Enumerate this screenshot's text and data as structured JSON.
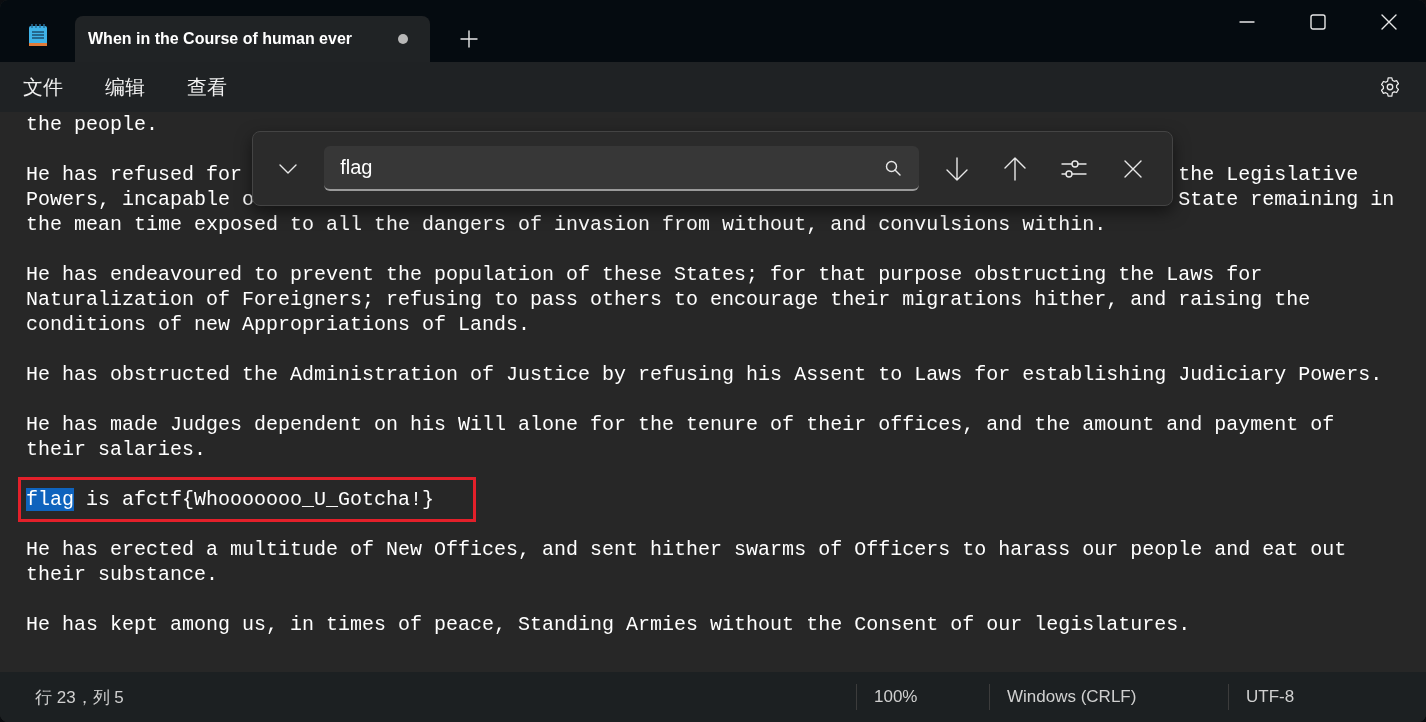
{
  "tab": {
    "label": "When in the Course of human ever",
    "selected": true,
    "unsaved": true
  },
  "menu": [
    {
      "label": "文件"
    },
    {
      "label": "编辑"
    },
    {
      "label": "查看"
    }
  ],
  "find": {
    "value": "flag"
  },
  "lines": [
    {
      "kind": "text",
      "text": "the people."
    },
    {
      "kind": "blank"
    },
    {
      "kind": "split",
      "text": "He has refused for ",
      "right": "the Legislative"
    },
    {
      "kind": "split",
      "text": "Powers, incapable o",
      "right": "State remaining in"
    },
    {
      "kind": "text",
      "text": "the mean time exposed to all the dangers of invasion from without, and convulsions within."
    },
    {
      "kind": "blank"
    },
    {
      "kind": "text",
      "text": "He has endeavoured to prevent the population of these States; for that purpose obstructing the Laws for"
    },
    {
      "kind": "text",
      "text": "Naturalization of Foreigners; refusing to pass others to encourage their migrations hither, and raising the"
    },
    {
      "kind": "text",
      "text": "conditions of new Appropriations of Lands."
    },
    {
      "kind": "blank"
    },
    {
      "kind": "text",
      "text": "He has obstructed the Administration of Justice by refusing his Assent to Laws for establishing Judiciary Powers."
    },
    {
      "kind": "blank"
    },
    {
      "kind": "text",
      "text": "He has made Judges dependent on his Will alone for the tenure of their offices, and the amount and payment of"
    },
    {
      "kind": "text",
      "text": "their salaries."
    },
    {
      "kind": "blank"
    },
    {
      "kind": "selection",
      "selected_text": "flag",
      "text": " is afctf{Whooooooo_U_Gotcha!}",
      "annotated": true
    },
    {
      "kind": "blank"
    },
    {
      "kind": "text",
      "text": "He has erected a multitude of New Offices, and sent hither swarms of Officers to harass our people and eat out"
    },
    {
      "kind": "text",
      "text": "their substance."
    },
    {
      "kind": "blank"
    },
    {
      "kind": "text",
      "text": "He has kept among us, in times of peace, Standing Armies without the Consent of our legislatures."
    }
  ],
  "status_bar": {
    "position": "行 23，列 5",
    "zoom": "100%",
    "line_ending": "Windows (CRLF)",
    "encoding": "UTF-8"
  }
}
